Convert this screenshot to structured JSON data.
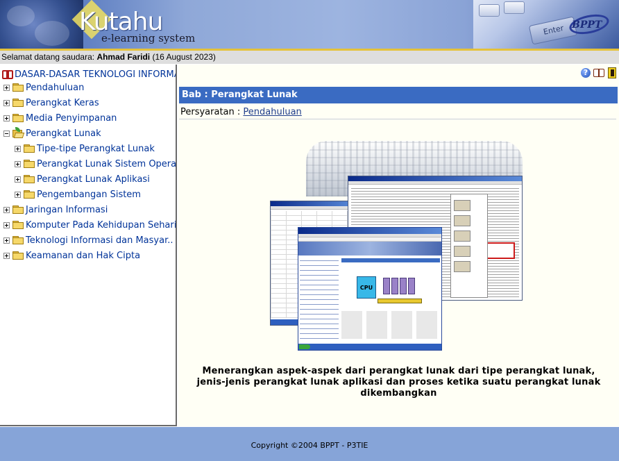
{
  "header": {
    "logo_word": "Kutahu",
    "logo_subtitle": "e-learning system",
    "enter_key_label": "Enter",
    "partner_logo": "BPPT"
  },
  "welcome": {
    "prefix": "Selamat datang saudara:",
    "user_name": "Ahmad Faridi",
    "date": "(16 August 2023)"
  },
  "sidebar": {
    "root_label": "DASAR-DASAR TEKNOLOGI INFORMAS..",
    "items": [
      {
        "label": "Pendahuluan",
        "expander": "plus"
      },
      {
        "label": "Perangkat Keras",
        "expander": "plus"
      },
      {
        "label": "Media Penyimpanan",
        "expander": "plus"
      },
      {
        "label": "Perangkat Lunak",
        "expander": "minus",
        "children": [
          {
            "label": "Tipe-tipe Perangkat Lunak",
            "expander": "plus"
          },
          {
            "label": "Perangkat Lunak Sistem Operasi",
            "expander": "plus"
          },
          {
            "label": "Perangkat Lunak Aplikasi",
            "expander": "plus"
          },
          {
            "label": "Pengembangan Sistem",
            "expander": "plus"
          }
        ]
      },
      {
        "label": "Jaringan Informasi",
        "expander": "plus"
      },
      {
        "label": "Komputer Pada Kehidupan Sehari..",
        "expander": "plus"
      },
      {
        "label": "Teknologi Informasi dan Masyar..",
        "expander": "plus"
      },
      {
        "label": "Keamanan dan Hak Cipta",
        "expander": "plus"
      }
    ]
  },
  "content": {
    "chapter_title": "Bab : Perangkat Lunak",
    "prerequisite_label": "Persyaratan :",
    "prerequisite_link": "Pendahuluan",
    "illustration_cpu_label": "CPU",
    "description": "Menerangkan aspek-aspek dari perangkat lunak dari tipe perangkat lunak, jenis-jenis perangkat lunak aplikasi dan proses ketika suatu perangkat lunak dikembangkan",
    "toolbar_icons": [
      "help-icon",
      "open-book-icon",
      "exit-door-icon"
    ]
  },
  "footer": {
    "copyright": "Copyright ©2004 BPPT - P3TIE"
  },
  "colors": {
    "header_blue": "#8fa8d8",
    "gold_rule": "#e5c23a",
    "chapter_bar": "#3a6bc2",
    "tree_link": "#003399",
    "footer_blue": "#86a4d8",
    "content_bg": "#fffff5"
  }
}
